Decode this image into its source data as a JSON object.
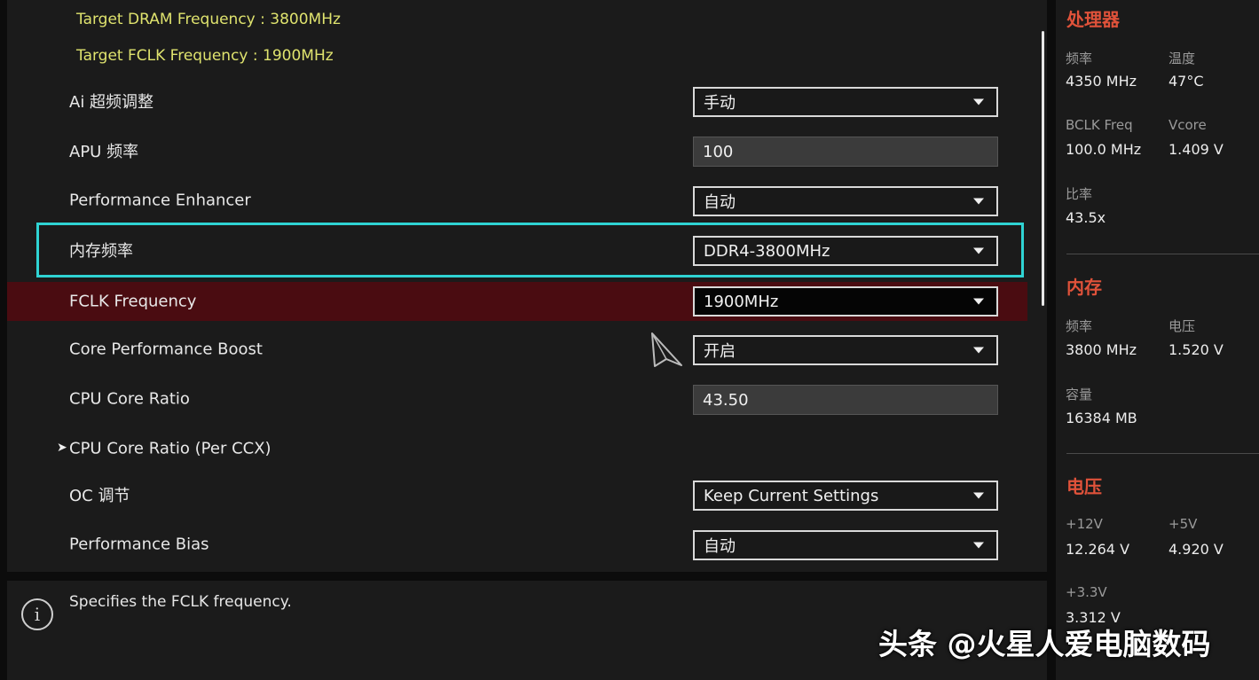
{
  "main": {
    "target_dram": "Target DRAM Frequency : 3800MHz",
    "target_fclk": "Target FCLK Frequency : 1900MHz",
    "rows": [
      {
        "label": "Ai 超频调整",
        "value": "手动"
      },
      {
        "label": "APU 频率",
        "value": "100"
      },
      {
        "label": "Performance Enhancer",
        "value": "自动"
      },
      {
        "label": "内存频率",
        "value": "DDR4-3800MHz"
      },
      {
        "label": "FCLK Frequency",
        "value": "1900MHz"
      },
      {
        "label": "Core Performance Boost",
        "value": "开启"
      },
      {
        "label": "CPU Core Ratio",
        "value": "43.50"
      },
      {
        "label": "CPU Core Ratio (Per CCX)"
      },
      {
        "label": "OC 调节",
        "value": "Keep Current Settings"
      },
      {
        "label": "Performance Bias",
        "value": "自动"
      }
    ],
    "submenu_arrow": "➤"
  },
  "help": {
    "icon": "i",
    "text": "Specifies the FCLK frequency."
  },
  "side": {
    "cpu": {
      "title": "处理器",
      "freq_label": "频率",
      "freq_value": "4350 MHz",
      "temp_label": "温度",
      "temp_value": "47°C",
      "bclk_label": "BCLK Freq",
      "bclk_value": "100.0 MHz",
      "vcore_label": "Vcore",
      "vcore_value": "1.409 V",
      "ratio_label": "比率",
      "ratio_value": "43.5x"
    },
    "memory": {
      "title": "内存",
      "freq_label": "频率",
      "freq_value": "3800 MHz",
      "volt_label": "电压",
      "volt_value": "1.520 V",
      "cap_label": "容量",
      "cap_value": "16384 MB"
    },
    "voltage": {
      "title": "电压",
      "v12_label": "+12V",
      "v12_value": "12.264 V",
      "v5_label": "+5V",
      "v5_value": "4.920 V",
      "v33_label": "+3.3V",
      "v33_value": "3.312 V"
    }
  },
  "watermark": "头条 @火星人爱电脑数码",
  "colors": {
    "accent": "#e0523a",
    "highlight": "#2fd3d3",
    "selected_row": "#4a0c11",
    "target_text": "#dfe36e"
  }
}
